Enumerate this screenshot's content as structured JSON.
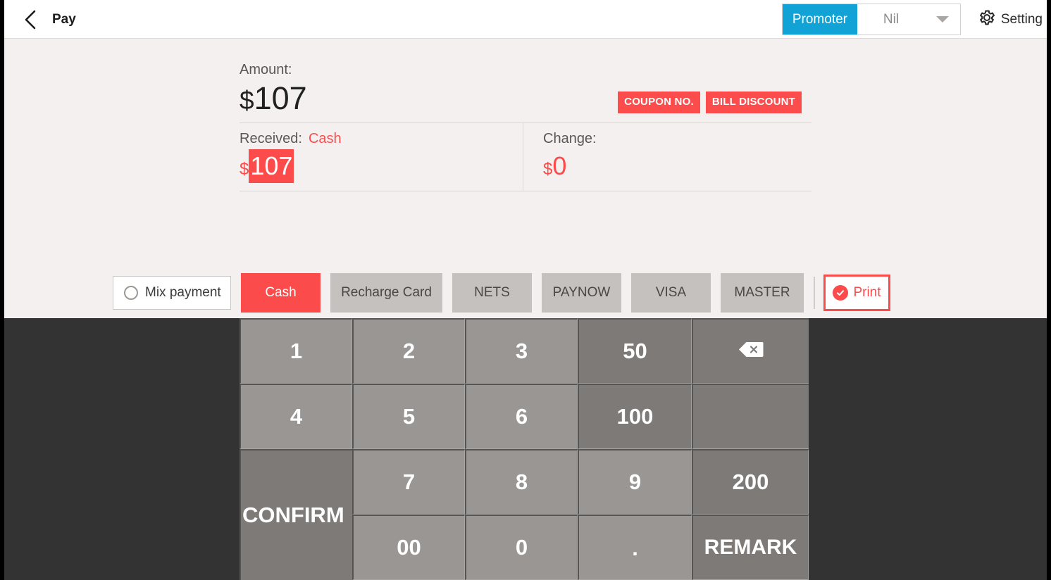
{
  "header": {
    "back_icon": "chevron-left-icon",
    "title": "Pay",
    "promoter_label": "Promoter",
    "promoter_value": "Nil",
    "caret_icon": "chevron-down-icon",
    "setting_icon": "gear-icon",
    "setting_label": "Setting"
  },
  "amount": {
    "label": "Amount:",
    "currency": "$",
    "value": "107",
    "coupon_button": "COUPON NO.",
    "bill_discount_button": "BILL DISCOUNT"
  },
  "received": {
    "label": "Received:",
    "method": "Cash",
    "currency": "$",
    "value": "107"
  },
  "change": {
    "label": "Change:",
    "currency": "$",
    "value": "0"
  },
  "methods": {
    "mix_payment_label": "Mix payment",
    "mix_payment_radio": "radio-unchecked-icon",
    "buttons": [
      {
        "label": "Cash",
        "active": true
      },
      {
        "label": "Recharge Card",
        "active": false
      },
      {
        "label": "NETS",
        "active": false
      },
      {
        "label": "PAYNOW",
        "active": false
      },
      {
        "label": "VISA",
        "active": false
      },
      {
        "label": "MASTER",
        "active": false
      }
    ],
    "print_label": "Print",
    "print_icon": "check-circle-icon",
    "print_checked": true
  },
  "keypad": {
    "keys": [
      "1",
      "2",
      "3",
      "50",
      "4",
      "5",
      "6",
      "100",
      "7",
      "8",
      "9",
      "200",
      "00",
      "0",
      ".",
      "REMARK"
    ],
    "backspace_icon": "backspace-icon",
    "confirm_label": "CONFIRM"
  },
  "colors": {
    "accent_red": "#fb4b4b",
    "promoter_blue": "#11a2d6",
    "keypad_dark": "#333333",
    "key_gray": "#999694",
    "key_quick_gray": "#7d7a78",
    "page_bg": "#f4f0ef"
  }
}
